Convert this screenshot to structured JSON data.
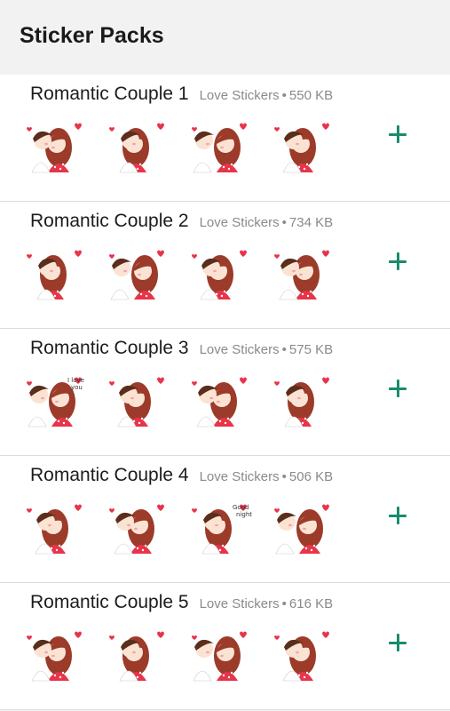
{
  "header": {
    "title": "Sticker Packs"
  },
  "accent_color": "#1a8a6e",
  "sticker_icon": "couple-sticker",
  "packs": [
    {
      "name": "Romantic Couple 1",
      "publisher": "Love Stickers",
      "separator": "•",
      "size": "550 KB",
      "add_icon": "plus-icon"
    },
    {
      "name": "Romantic Couple 2",
      "publisher": "Love Stickers",
      "separator": "•",
      "size": "734 KB",
      "add_icon": "plus-icon"
    },
    {
      "name": "Romantic Couple 3",
      "publisher": "Love Stickers",
      "separator": "•",
      "size": "575 KB",
      "add_icon": "plus-icon"
    },
    {
      "name": "Romantic Couple 4",
      "publisher": "Love Stickers",
      "separator": "•",
      "size": "506 KB",
      "add_icon": "plus-icon"
    },
    {
      "name": "Romantic Couple 5",
      "publisher": "Love Stickers",
      "separator": "•",
      "size": "616 KB",
      "add_icon": "plus-icon"
    }
  ],
  "sticker_captions": {
    "pack3_sticker1": [
      "I love",
      "you"
    ],
    "pack4_sticker3": [
      "Good",
      "night"
    ]
  }
}
